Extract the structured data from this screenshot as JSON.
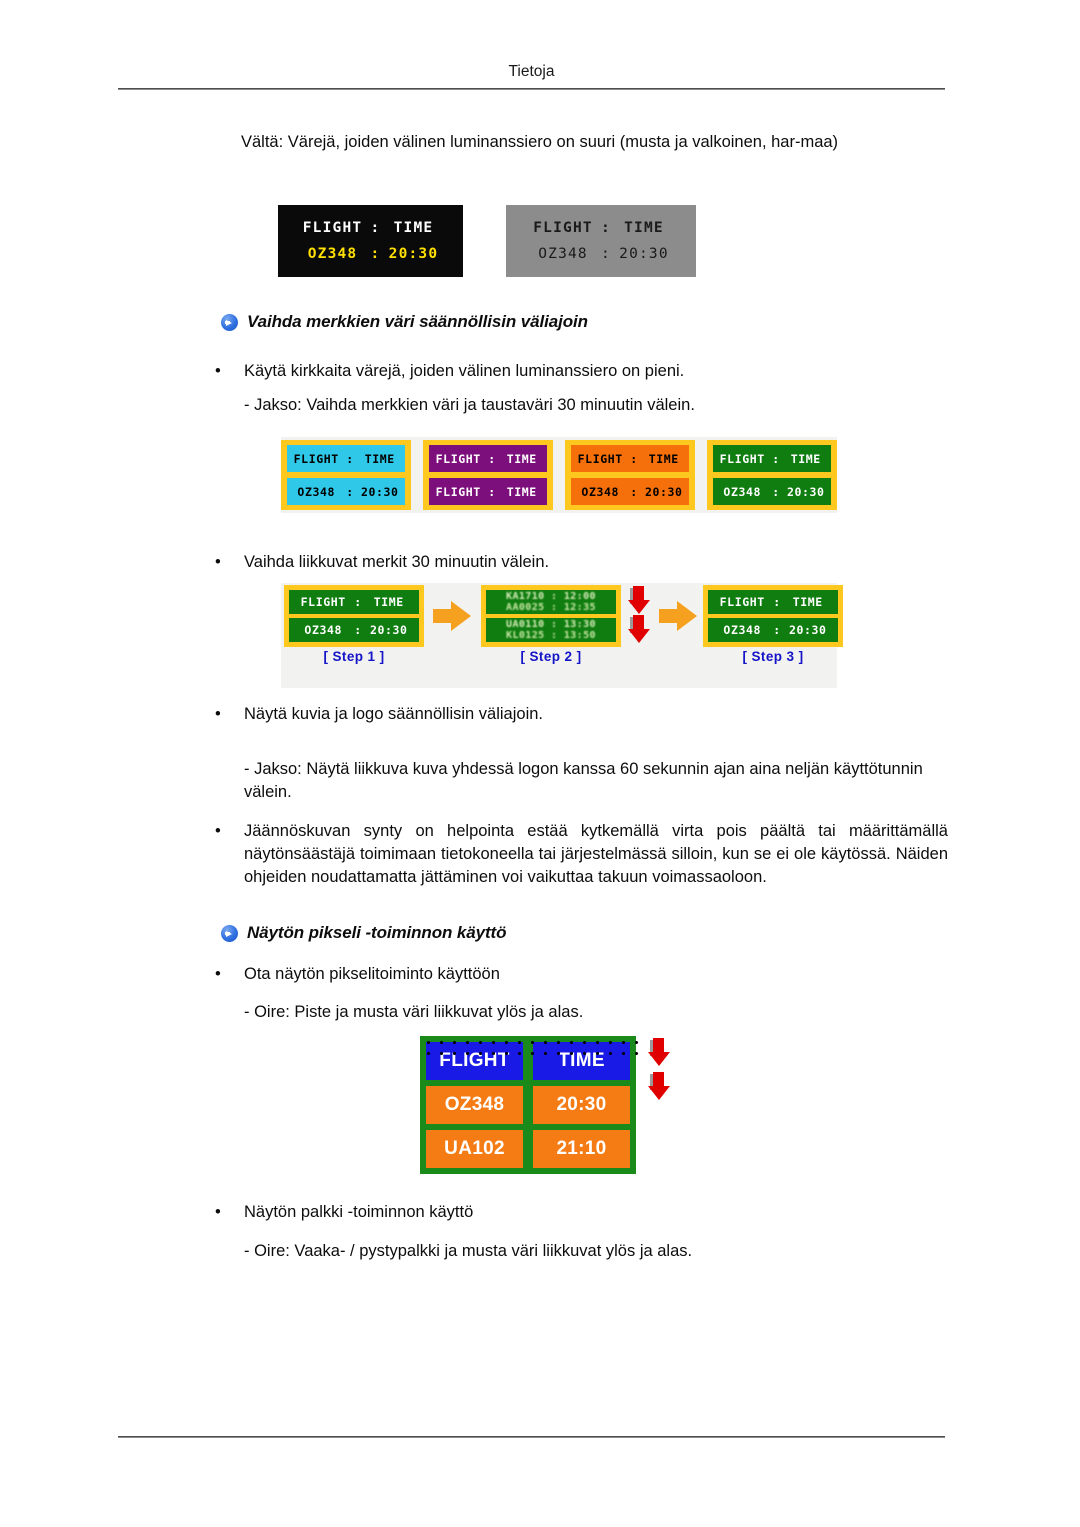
{
  "header": {
    "title": "Tietoja"
  },
  "intro": {
    "text": "Vältä: Värejä, joiden välinen luminanssiero on suuri (musta ja valkoinen, har-maa)"
  },
  "figure_black_gray": {
    "boards": [
      {
        "name": "black-board",
        "background": "#0a0a0a",
        "rows": [
          {
            "col1": "FLIGHT",
            "sep": ":",
            "col2": "TIME",
            "color": "#ffffff"
          },
          {
            "col1": "OZ348",
            "sep": ":",
            "col2": "20:30",
            "color": "#ffe000"
          }
        ]
      },
      {
        "name": "gray-board",
        "background": "#8c8c8c",
        "rows": [
          {
            "col1": "FLIGHT",
            "sep": ":",
            "col2": "TIME",
            "color": "#1a1a1a"
          },
          {
            "col1": "OZ348",
            "sep": ":",
            "col2": "20:30",
            "color": "#1a1a1a"
          }
        ]
      }
    ]
  },
  "heading1": {
    "icon": "blue-arrow-icon",
    "text": "Vaihda merkkien väri säännöllisin väliajoin"
  },
  "bullet1": {
    "dot": "•",
    "text": "Käytä kirkkaita värejä, joiden välinen luminanssiero on pieni."
  },
  "subline1": {
    "text": "- Jakso: Vaihda merkkien väri ja taustaväri 30 minuutin välein."
  },
  "figure_color_boards": {
    "boards": [
      {
        "name": "cyan-board",
        "frame": "#ffc81e",
        "cell_bg": "#2fc8e8",
        "text_color": "#000000",
        "rows": [
          {
            "col1": "FLIGHT",
            "sep": ":",
            "col2": "TIME"
          },
          {
            "col1": "OZ348",
            "sep": ":",
            "col2": "20:30"
          }
        ]
      },
      {
        "name": "purple-board",
        "frame": "#ffc81e",
        "cell_bg": "#7d0f7d",
        "text_color": "#ffffff",
        "rows": [
          {
            "col1": "FLIGHT",
            "sep": ":",
            "col2": "TIME"
          },
          {
            "col1": "FLIGHT",
            "sep": ":",
            "col2": "TIME"
          }
        ]
      },
      {
        "name": "orange-board",
        "frame": "#ffc81e",
        "cell_bg": "#f5700a",
        "text_color": "#000000",
        "rows": [
          {
            "col1": "FLIGHT",
            "sep": ":",
            "col2": "TIME"
          },
          {
            "col1": "OZ348",
            "sep": ":",
            "col2": "20:30"
          }
        ]
      },
      {
        "name": "green-board",
        "frame": "#ffc81e",
        "cell_bg": "#107d10",
        "text_color": "#ffffff",
        "rows": [
          {
            "col1": "FLIGHT",
            "sep": ":",
            "col2": "TIME"
          },
          {
            "col1": "OZ348",
            "sep": ":",
            "col2": "20:30"
          }
        ]
      }
    ]
  },
  "bullet2": {
    "dot": "•",
    "text": "Vaihda liikkuvat merkit 30 minuutin välein."
  },
  "figure_steps": {
    "steps": [
      {
        "label": "[ Step 1 ]",
        "rows": [
          {
            "col1": "FLIGHT",
            "sep": ":",
            "col2": "TIME"
          },
          {
            "col1": "OZ348",
            "sep": ":",
            "col2": "20:30"
          }
        ]
      },
      {
        "label": "[ Step 2 ]",
        "scrolling": true,
        "rows": [
          {
            "line1": "KA1710  :  12:00",
            "line2": "AA0025  :  12:35"
          },
          {
            "line1": "UA0110  :  13:30",
            "line2": "KL0125  :  13:50"
          }
        ]
      },
      {
        "label": "[ Step 3 ]",
        "rows": [
          {
            "col1": "FLIGHT",
            "sep": ":",
            "col2": "TIME"
          },
          {
            "col1": "OZ348",
            "sep": ":",
            "col2": "20:30"
          }
        ]
      }
    ],
    "arrow_right_color": "#f5a01e",
    "arrow_down_color": "#e00000"
  },
  "bullet3": {
    "dot": "•",
    "text": "Näytä kuvia ja logo säännöllisin väliajoin."
  },
  "subline2": {
    "text": "- Jakso: Näytä liikkuva kuva yhdessä logon kanssa 60 sekunnin ajan aina neljän käyttötunnin välein."
  },
  "bullet4": {
    "dot": "•",
    "text": "Jäännöskuvan synty on helpointa estää kytkemällä virta pois päältä tai määrittämällä näytönsäästäjä toimimaan tietokoneella tai järjestelmässä silloin, kun se ei ole käytössä. Näiden ohjeiden noudattamatta jättäminen voi vaikuttaa takuun voimassaoloon."
  },
  "heading2": {
    "icon": "blue-arrow-icon",
    "text": "Näytön pikseli -toiminnon käyttö"
  },
  "bullet5": {
    "dot": "•",
    "text": "Ota näytön pikselitoiminto käyttöön"
  },
  "subline3": {
    "text": "- Oire: Piste ja musta väri liikkuvat ylös ja alas."
  },
  "figure_pixel_board": {
    "frame_color": "#1a8a1a",
    "header_bg": "#1a1ae6",
    "data_bg": "#f57c14",
    "rows": [
      {
        "col1": "FLIGHT",
        "col2": "TIME"
      },
      {
        "col1": "OZ348",
        "col2": "20:30"
      },
      {
        "col1": "UA102",
        "col2": "21:10"
      }
    ],
    "arrow_color": "#e00000"
  },
  "bullet6": {
    "dot": "•",
    "text": "Näytön palkki -toiminnon käyttö"
  },
  "subline4": {
    "text": "- Oire: Vaaka- / pystypalkki ja musta väri liikkuvat ylös ja alas."
  }
}
